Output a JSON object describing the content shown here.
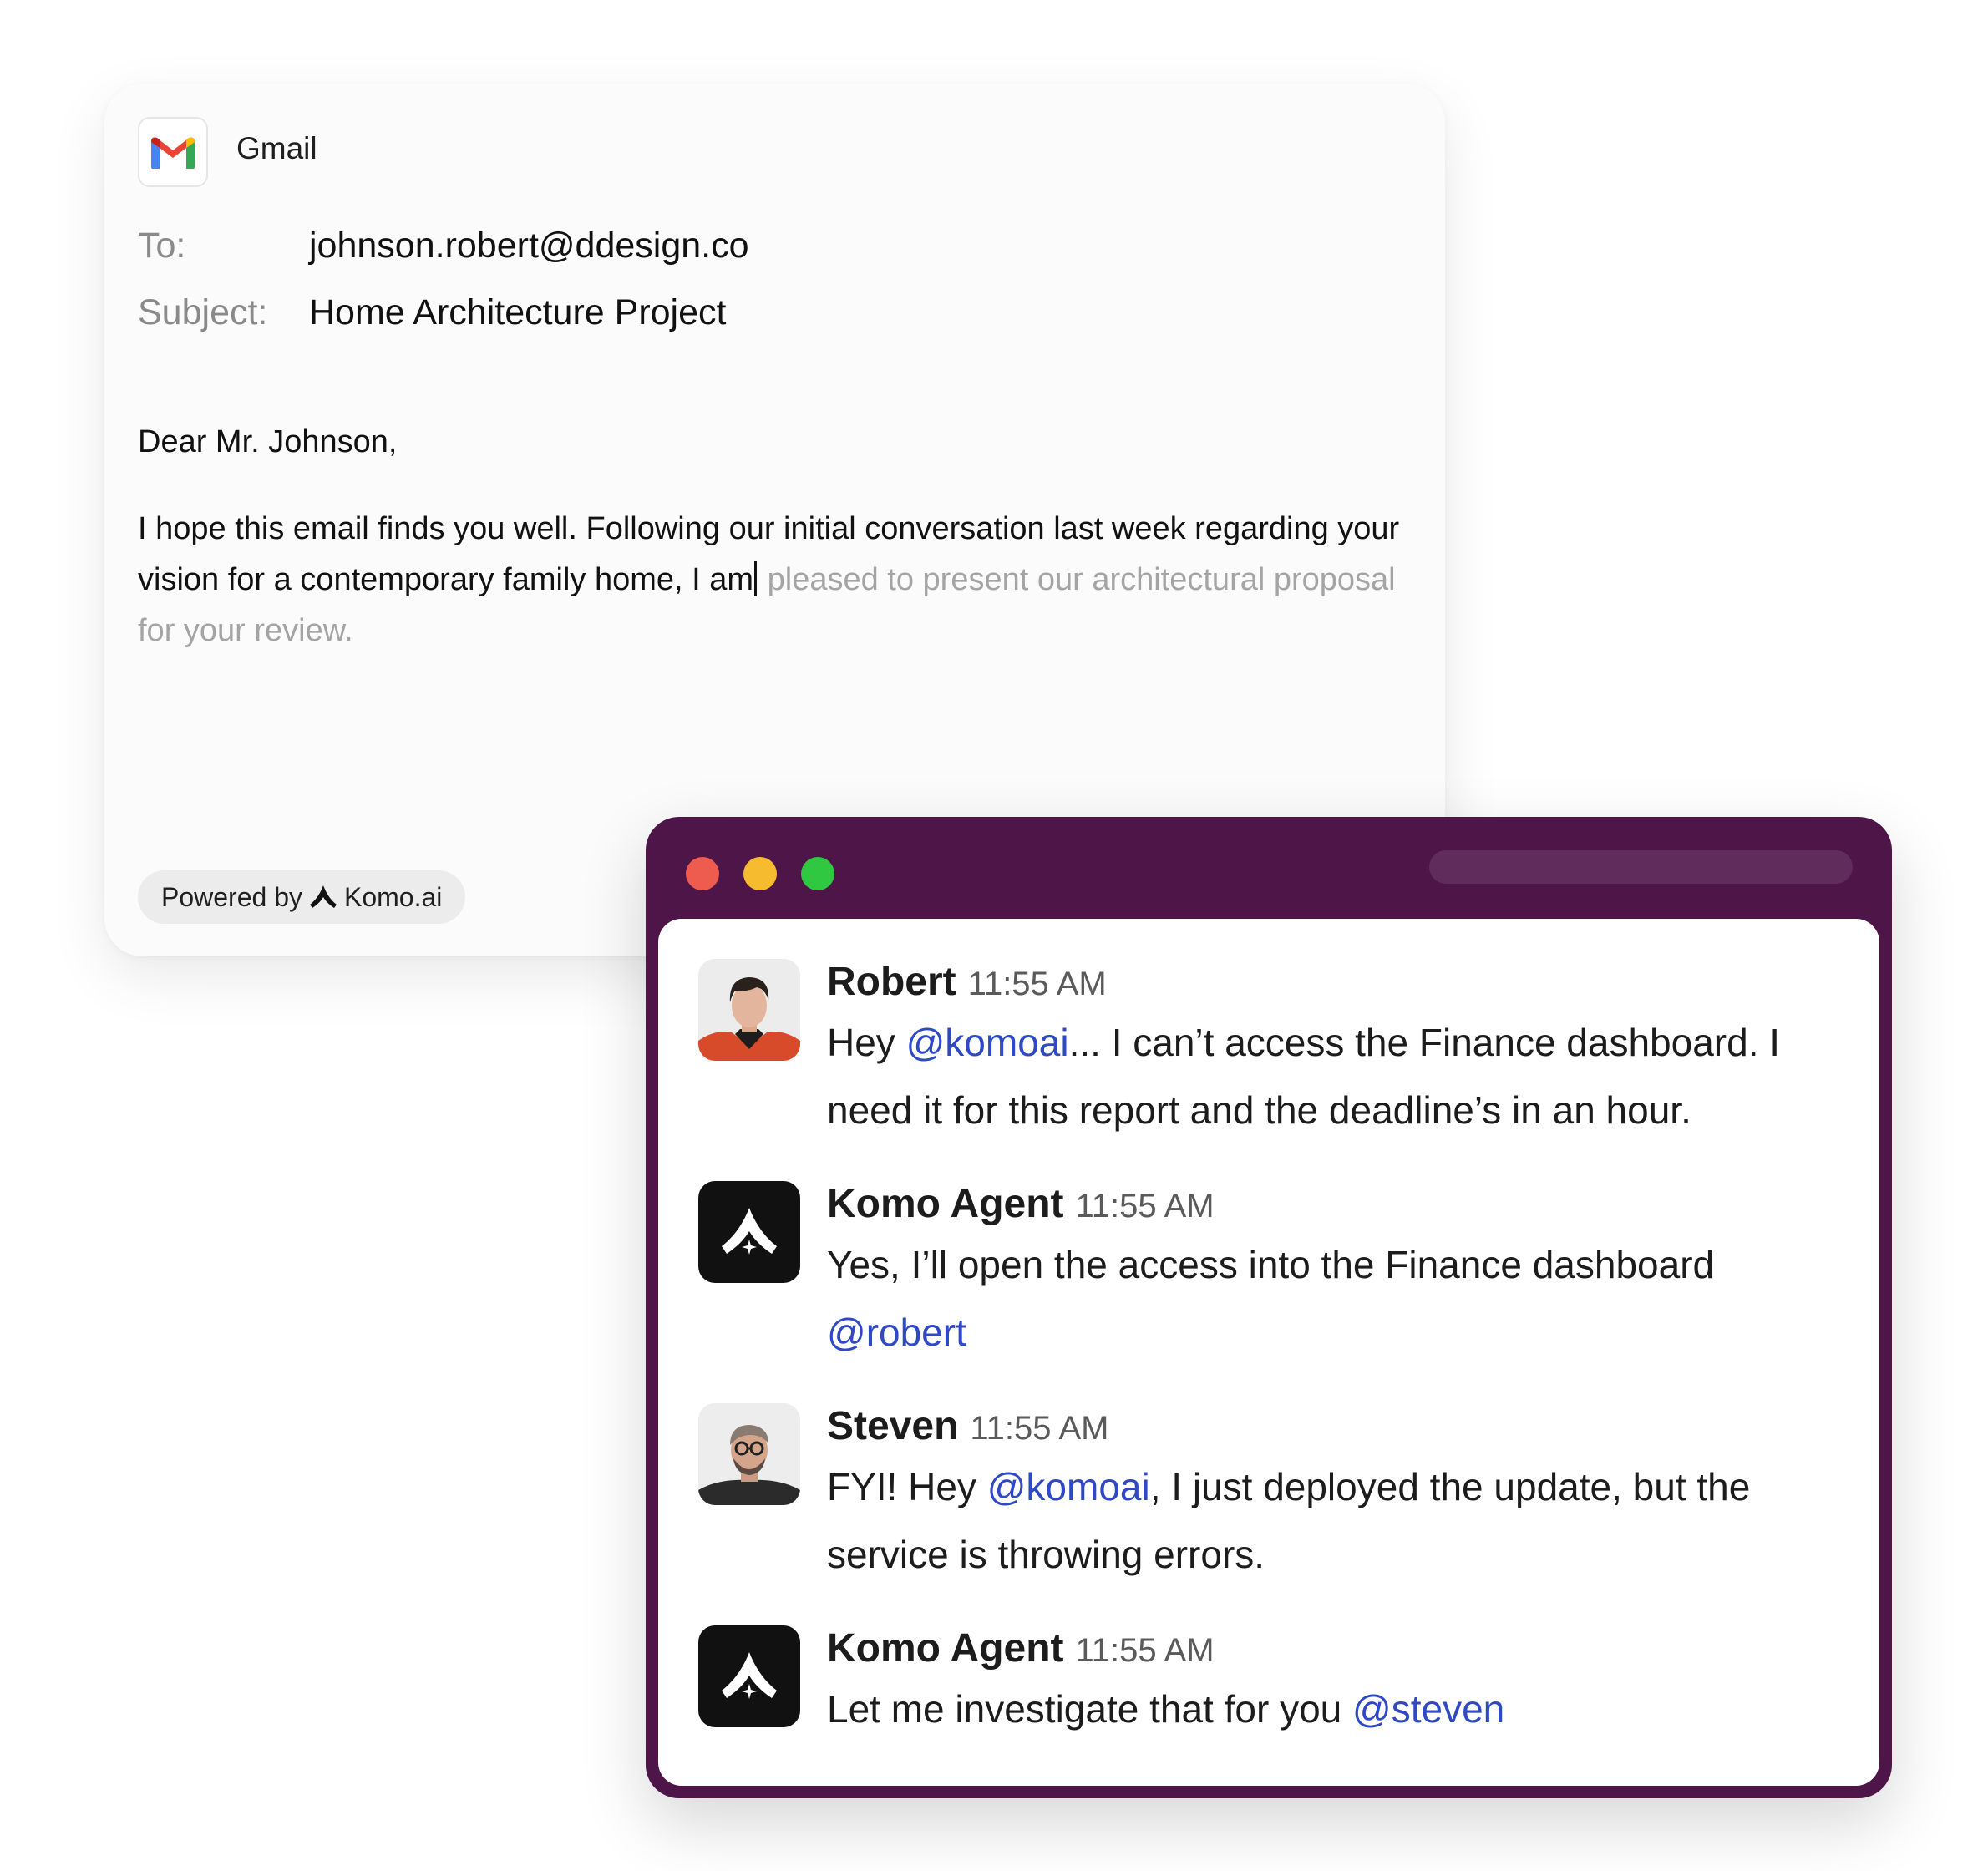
{
  "email": {
    "app_name": "Gmail",
    "to_label": "To:",
    "to_value": "johnson.robert@ddesign.co",
    "subject_label": "Subject:",
    "subject_value": "Home Architecture Project",
    "greeting": "Dear Mr. Johnson,",
    "body_typed": "I hope this email finds you well. Following our initial conversation last week regarding your vision for a contemporary family home, I am",
    "body_suggestion": " pleased to present our architectural proposal for your review.",
    "powered_by_label": "Powered by",
    "powered_by_brand": "Komo.ai"
  },
  "chat": {
    "messages": [
      {
        "sender": "Robert",
        "time": "11:55 AM",
        "avatar": "robert-photo",
        "text_1": "Hey ",
        "mention_1": "@komoai",
        "text_2": "... I can’t access the Finance dashboard. I need it for this report and the deadline’s in an hour."
      },
      {
        "sender": "Komo Agent",
        "time": "11:55 AM",
        "avatar": "komo-logo",
        "text_1": "Yes, I’ll open the access into the Finance dashboard ",
        "mention_1": "@robert"
      },
      {
        "sender": "Steven",
        "time": "11:55 AM",
        "avatar": "steven-photo",
        "text_1": "FYI! Hey ",
        "mention_1": "@komoai",
        "text_2": ", I just deployed the update, but the service is throwing errors."
      },
      {
        "sender": "Komo Agent",
        "time": "11:55 AM",
        "avatar": "komo-logo",
        "text_1": "Let me investigate that for you ",
        "mention_1": "@steven"
      }
    ]
  },
  "colors": {
    "chat_frame": "#4d1548",
    "mention": "#2f49c4",
    "suggestion_text": "#a4a4a4",
    "window_red": "#ee5c50",
    "window_yellow": "#f6bb2f",
    "window_green": "#2fc840"
  }
}
